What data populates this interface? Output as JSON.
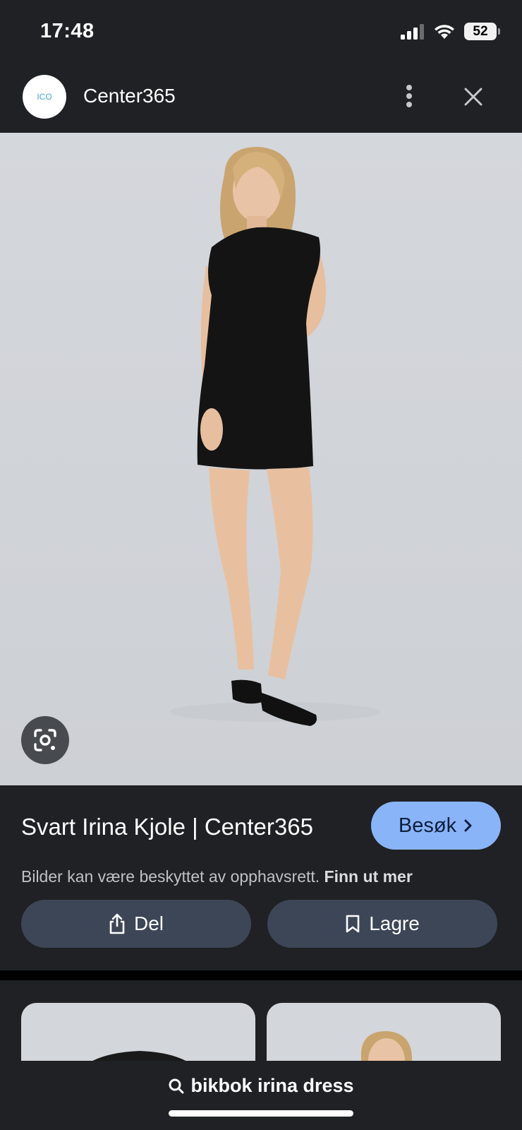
{
  "status_bar": {
    "time": "17:48",
    "battery": "52",
    "icons": [
      "signal-icon",
      "wifi-icon",
      "battery-icon"
    ]
  },
  "header": {
    "logo_text": "ICO",
    "site_name": "Center365",
    "icons": [
      "more-vert-icon",
      "close-icon"
    ]
  },
  "image": {
    "description_icon": "lens-icon"
  },
  "info": {
    "title": "Svart Irina Kjole | Center365",
    "visit_label": "Besøk",
    "copyright_text": "Bilder kan være beskyttet av opphavsrett.",
    "copyright_link": "Finn ut mer",
    "share_label": "Del",
    "save_label": "Lagre"
  },
  "search": {
    "query": "bikbok irina dress"
  },
  "colors": {
    "background": "#202124",
    "accent": "#8ab4f8",
    "button": "#3c4657",
    "image_bg": "#d4d7dc"
  }
}
